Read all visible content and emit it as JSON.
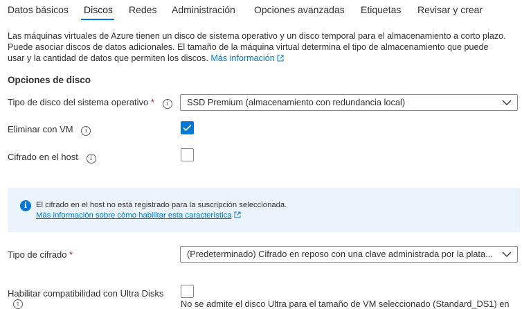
{
  "tabs": [
    {
      "label": "Datos básicos"
    },
    {
      "label": "Discos"
    },
    {
      "label": "Redes"
    },
    {
      "label": "Administración"
    },
    {
      "label": "Opciones avanzadas"
    },
    {
      "label": "Etiquetas"
    },
    {
      "label": "Revisar y crear"
    }
  ],
  "active_tab": "Discos",
  "intro": {
    "line1": "Las máquinas virtuales de Azure tienen un disco de sistema operativo y un disco temporal para el almacenamiento a corto plazo.",
    "line2": "Puede asociar discos de datos adicionales. El tamaño de la máquina virtual determina el tipo de almacenamiento que puede",
    "line3": "usar y la cantidad de datos que permiten los discos.",
    "link": "Más información"
  },
  "section_title": "Opciones de disco",
  "os_disk_type": {
    "label": "Tipo de disco del sistema operativo",
    "required_mark": "*",
    "value": "SSD Premium (almacenamiento con redundancia local)"
  },
  "delete_with_vm": {
    "label": "Eliminar con VM",
    "checked": true
  },
  "encryption_at_host": {
    "label": "Cifrado en el host",
    "checked": false
  },
  "info_banner": {
    "message": "El cifrado en el host no está registrado para la suscripción seleccionada.",
    "link": "Más información sobre cómo habilitar esta característica"
  },
  "encryption_type": {
    "label": "Tipo de cifrado",
    "required_mark": "*",
    "value": "(Predeterminado) Cifrado en reposo con una clave administrada por la plata..."
  },
  "ultra_disks": {
    "label": "Habilitar compatibilidad con Ultra Disks",
    "checked": false,
    "note": "No se admite el disco Ultra para el tamaño de VM seleccionado (Standard_DS1) en"
  },
  "colors": {
    "accent": "#0078d4",
    "required": "#a4262c",
    "banner_bg": "#ebf3fc"
  }
}
